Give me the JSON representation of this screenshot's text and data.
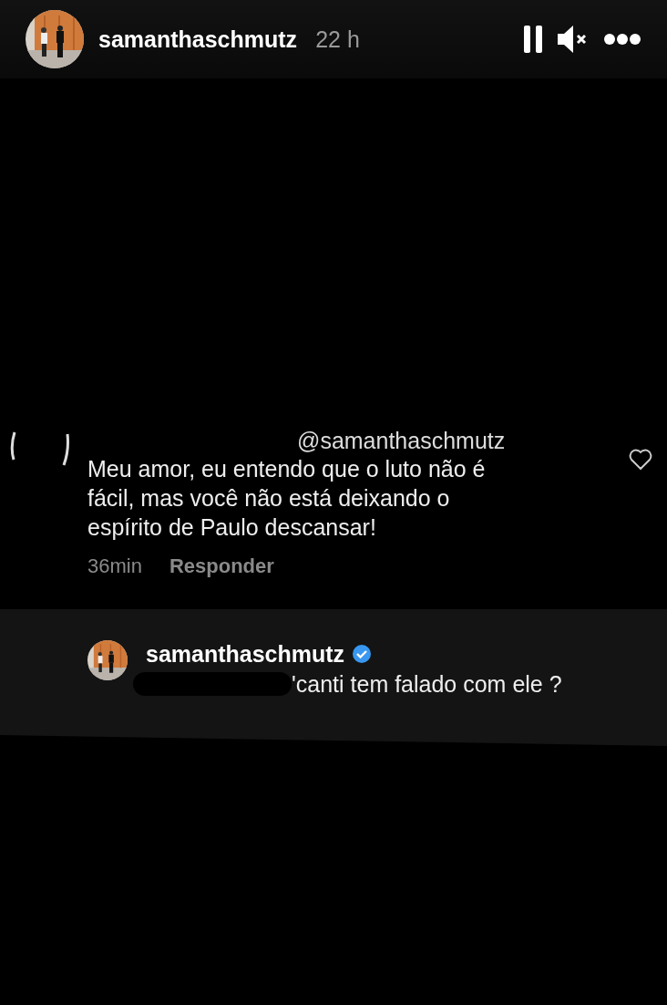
{
  "header": {
    "username": "samanthaschmutz",
    "time": "22 h",
    "paused": false,
    "muted": true
  },
  "comment": {
    "mention": "@samanthaschmutz",
    "text": "Meu amor, eu entendo que o luto não é fácil, mas você não está deixando o espírito de Paulo descansar!",
    "time": "36min",
    "reply_label": "Responder",
    "liked": false
  },
  "reply": {
    "username": "samanthaschmutz",
    "verified": true,
    "text": "'canti tem falado com ele ?"
  }
}
